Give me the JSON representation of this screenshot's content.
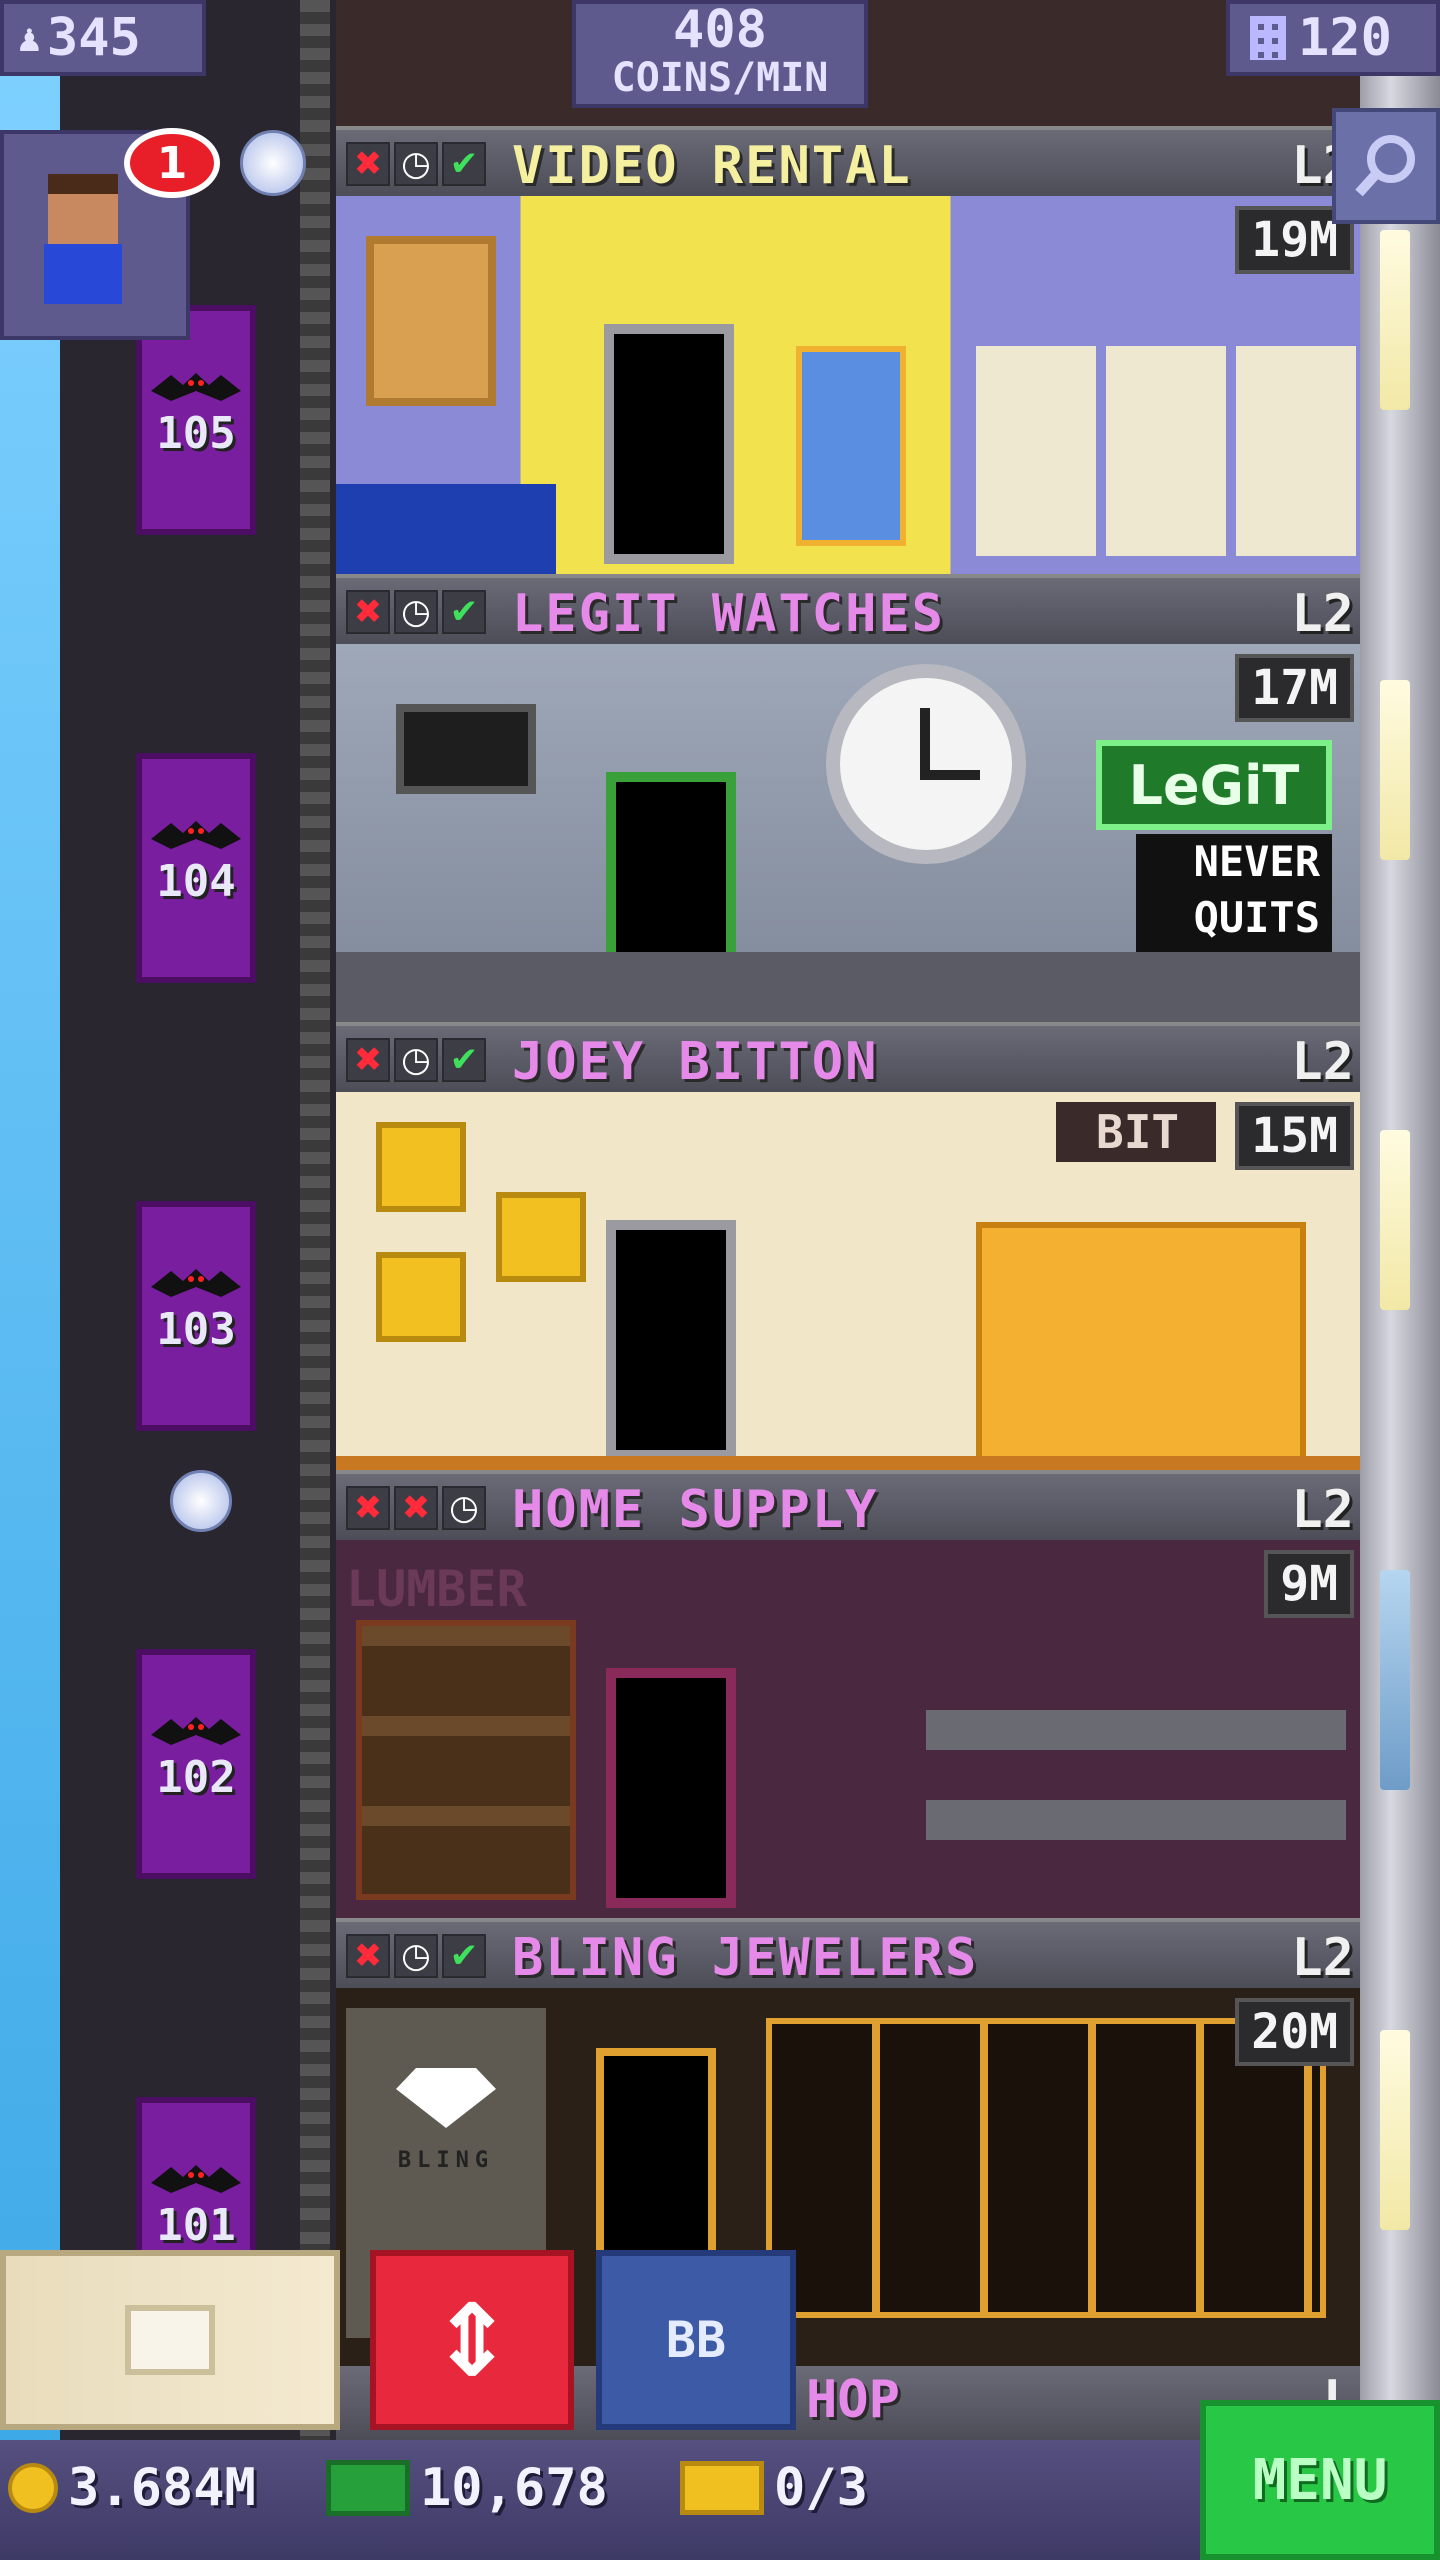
{
  "hud": {
    "population": "345",
    "coins_per_min_value": "408",
    "coins_per_min_unit": "COINS/MIN",
    "floors_count": "120"
  },
  "notification_badge": "1",
  "shaft_floors": [
    "105",
    "104",
    "103",
    "102",
    "101"
  ],
  "floors": [
    {
      "name": "VIDEO RENTAL",
      "level": "L2",
      "value": "19M",
      "name_color": "#f4f0a0",
      "status": [
        "x",
        "clock",
        "check"
      ]
    },
    {
      "name": "LEGIT WATCHES",
      "level": "L2",
      "value": "17M",
      "name_color": "#e58ae8",
      "status": [
        "x",
        "clock",
        "check"
      ],
      "sign_top": "LeGiT",
      "sign_bottom": [
        "NEVER",
        "QUITS"
      ]
    },
    {
      "name": "JOEY BITTON",
      "level": "L2",
      "value": "15M",
      "name_color": "#e58ae8",
      "status": [
        "x",
        "clock",
        "check"
      ],
      "sign": "BIT"
    },
    {
      "name": "HOME SUPPLY",
      "level": "L2",
      "value": "9M",
      "name_color": "#e58ae8",
      "status": [
        "x",
        "x",
        "clock"
      ],
      "sign": "LUMBER"
    },
    {
      "name": "BLING JEWELERS",
      "level": "L2",
      "value": "20M",
      "name_color": "#e58ae8",
      "status": [
        "x",
        "clock",
        "check"
      ],
      "sign": "BLING"
    }
  ],
  "partial_floor": {
    "name_fragment": "HOP",
    "level_fragment": "L"
  },
  "buttons": {
    "elevator_symbol": "⇕",
    "bitbook_label": "BB",
    "menu_label": "MENU"
  },
  "bottom_bar": {
    "coins": "3.684M",
    "bux": "10,678",
    "tickets": "0/3"
  },
  "colors": {
    "shaft_purple": "#7a1ea0",
    "menu_green": "#28c846",
    "elevator_red": "#e8283c",
    "bitbook_blue": "#3c5aa6"
  }
}
